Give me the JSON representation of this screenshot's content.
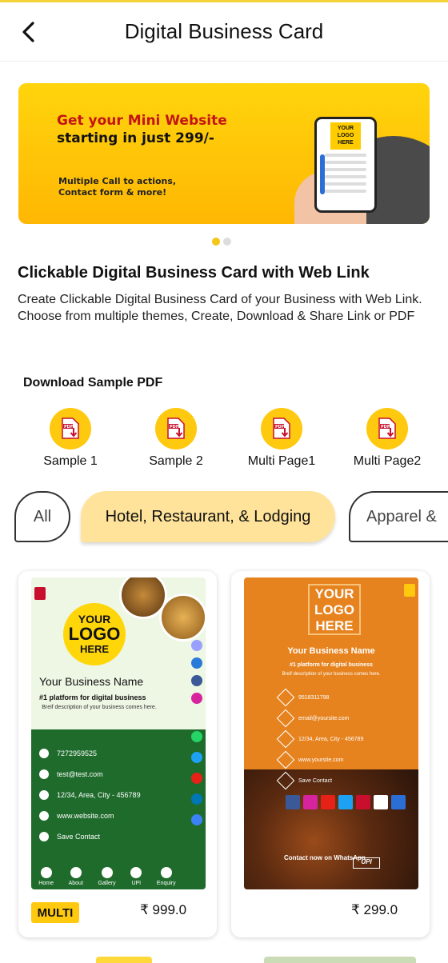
{
  "header": {
    "title": "Digital Business Card",
    "back_icon": "chevron-left-icon"
  },
  "banner": {
    "headline_1": "Get your Mini Website",
    "headline_2": "starting in just 299/-",
    "subline_1": "Multiple Call to actions,",
    "subline_2": "Contact form & more!",
    "phone_logo": "YOUR LOGO HERE",
    "active_slide": 1,
    "slide_count": 2
  },
  "intro": {
    "title": "Clickable Digital Business Card with Web Link",
    "description": "Create Clickable Digital Business Card of your Business with Web Link. Choose from multiple themes, Create, Download & Share Link or PDF"
  },
  "downloads": {
    "title": "Download Sample PDF",
    "items": [
      {
        "label": "Sample 1",
        "icon": "pdf-download-icon"
      },
      {
        "label": "Sample 2",
        "icon": "pdf-download-icon"
      },
      {
        "label": "Multi Page1",
        "icon": "pdf-download-icon"
      },
      {
        "label": "Multi Page2",
        "icon": "pdf-download-icon"
      }
    ]
  },
  "categories": {
    "items": [
      "All",
      "Hotel, Restaurant, & Lodging",
      "Apparel &"
    ],
    "selected": "Hotel, Restaurant, & Lodging"
  },
  "cards": [
    {
      "badge": "MULTI",
      "price": "₹ 999.0",
      "preview": {
        "logo_1": "YOUR",
        "logo_2": "LOGO",
        "logo_3": "HERE",
        "business_name": "Your Business Name",
        "tagline": "#1 platform for digital business",
        "description": "Breif description of your business comes here.",
        "phone": "7272959525",
        "email": "test@test.com",
        "address": "12/34, Area, City - 456789",
        "website": "www.website.com",
        "save": "Save Contact",
        "nav": [
          "Home",
          "About",
          "Gallery",
          "UPI",
          "Enquiry"
        ],
        "accent": "#1f6b2c"
      }
    },
    {
      "badge": "",
      "price": "₹ 299.0",
      "preview": {
        "logo": "YOUR LOGO HERE",
        "business_name": "Your Business Name",
        "tagline": "#1 platform for digital business",
        "description": "Breif description of your business comes here.",
        "phone": "9518311798",
        "email": "email@yoursite.com",
        "address": "12/34, Area, City - 456789",
        "website": "www.yoursite.com",
        "save": "Save Contact",
        "whatsapp": "Contact now on WhatsApp",
        "upi": "UPI",
        "accent": "#e6831f"
      }
    }
  ]
}
